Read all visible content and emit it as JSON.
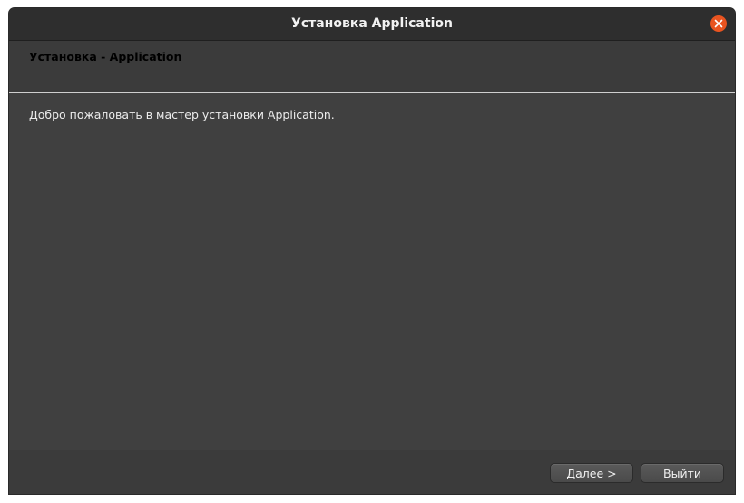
{
  "window": {
    "title": "Установка Application"
  },
  "header": {
    "title": "Установка - Application"
  },
  "content": {
    "welcome_text": "Добро пожаловать в мастер установки Application."
  },
  "footer": {
    "next_mnemonic": "Д",
    "next_rest": "алее >",
    "exit_mnemonic": "В",
    "exit_rest": "ыйти"
  },
  "icons": {
    "close": "close-icon"
  },
  "colors": {
    "close_button": "#e95420",
    "window_bg": "#404040",
    "titlebar_bg": "#2e2e2e"
  }
}
